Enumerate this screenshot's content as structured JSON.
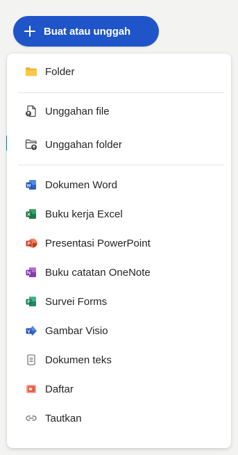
{
  "create_button": {
    "label": "Buat atau unggah",
    "icon": "plus-icon"
  },
  "colors": {
    "accent": "#1f55c8",
    "word": "#2b62c9",
    "excel": "#1e7a45",
    "powerpoint": "#d2452c",
    "onenote": "#8a3bb8",
    "forms": "#1e8a60",
    "visio": "#3567c8",
    "folder": "#f2b531",
    "list": "#e6513a"
  },
  "menu": {
    "items": [
      {
        "label": "Folder",
        "icon": "folder-icon"
      },
      {
        "label": "Unggahan file",
        "icon": "file-upload-icon"
      },
      {
        "label": "Unggahan folder",
        "icon": "folder-upload-icon"
      },
      {
        "label": "Dokumen Word",
        "icon": "word-icon"
      },
      {
        "label": "Buku kerja Excel",
        "icon": "excel-icon"
      },
      {
        "label": "Presentasi PowerPoint",
        "icon": "powerpoint-icon"
      },
      {
        "label": "Buku catatan OneNote",
        "icon": "onenote-icon"
      },
      {
        "label": "Survei Forms",
        "icon": "forms-icon"
      },
      {
        "label": "Gambar Visio",
        "icon": "visio-icon"
      },
      {
        "label": "Dokumen teks",
        "icon": "text-document-icon"
      },
      {
        "label": "Daftar",
        "icon": "list-icon"
      },
      {
        "label": "Tautkan",
        "icon": "link-icon"
      }
    ]
  }
}
